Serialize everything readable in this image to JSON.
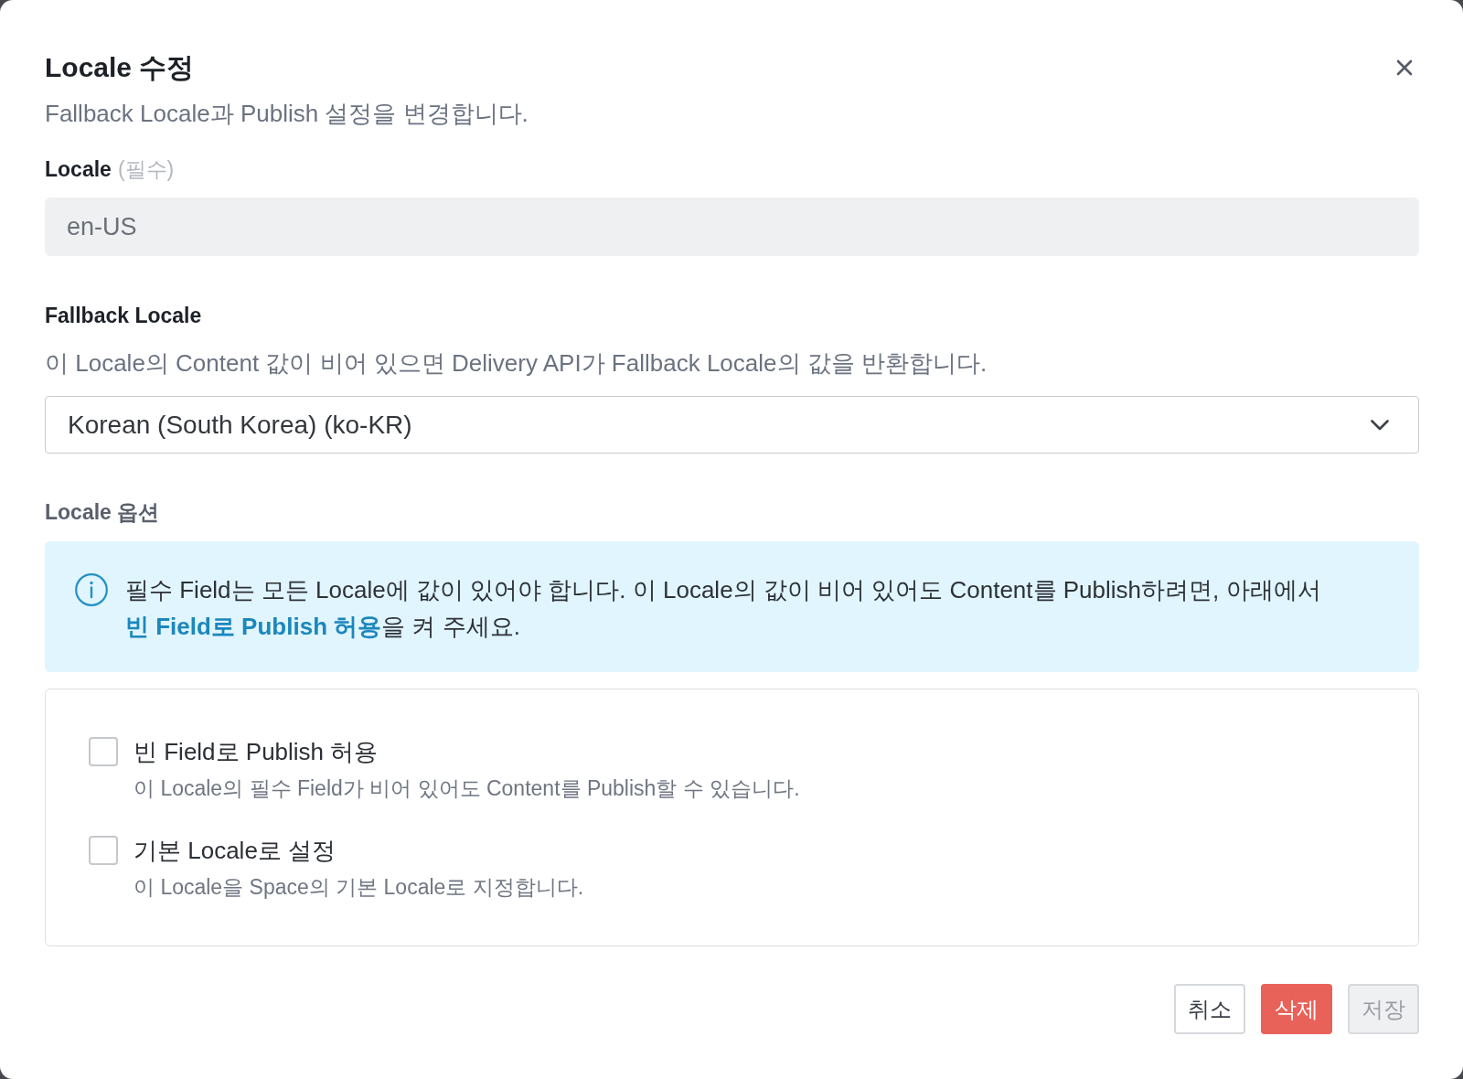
{
  "dialog": {
    "title": "Locale 수정",
    "subtitle": "Fallback Locale과 Publish 설정을 변경합니다."
  },
  "fields": [
    {
      "kind": "text",
      "label": "Locale",
      "required_note": "(필수)",
      "value": "en-US",
      "disabled": true
    },
    {
      "kind": "select",
      "label": "Fallback Locale",
      "hint": "이 Locale의 Content 값이 비어 있으면 Delivery API가 Fallback Locale의 값을 반환합니다.",
      "value": "Korean (South Korea) (ko-KR)"
    }
  ],
  "options": {
    "heading": "Locale 옵션",
    "notice": "필수 Field는 모든 Locale에 값이 있어야 합니다. 이 Locale의 값이 비어 있어도 Content를 Publish하려면, 아래에서 **빈 Field로 Publish 허용**을 켜 주세요.",
    "checkboxes": [
      {
        "label": "빈 Field로 Publish 허용",
        "description": "이 Locale의 필수 Field가 비어 있어도 Content를 Publish할 수 있습니다.",
        "checked": false
      },
      {
        "label": "기본 Locale로 설정",
        "description": "이 Locale을 Space의 기본 Locale로 지정합니다.",
        "checked": false
      }
    ]
  },
  "buttons": [
    {
      "label": "취소",
      "kind": "secondary",
      "disabled": false
    },
    {
      "label": "삭제",
      "kind": "danger",
      "disabled": false
    },
    {
      "label": "저장",
      "kind": "primary",
      "disabled": true
    }
  ]
}
